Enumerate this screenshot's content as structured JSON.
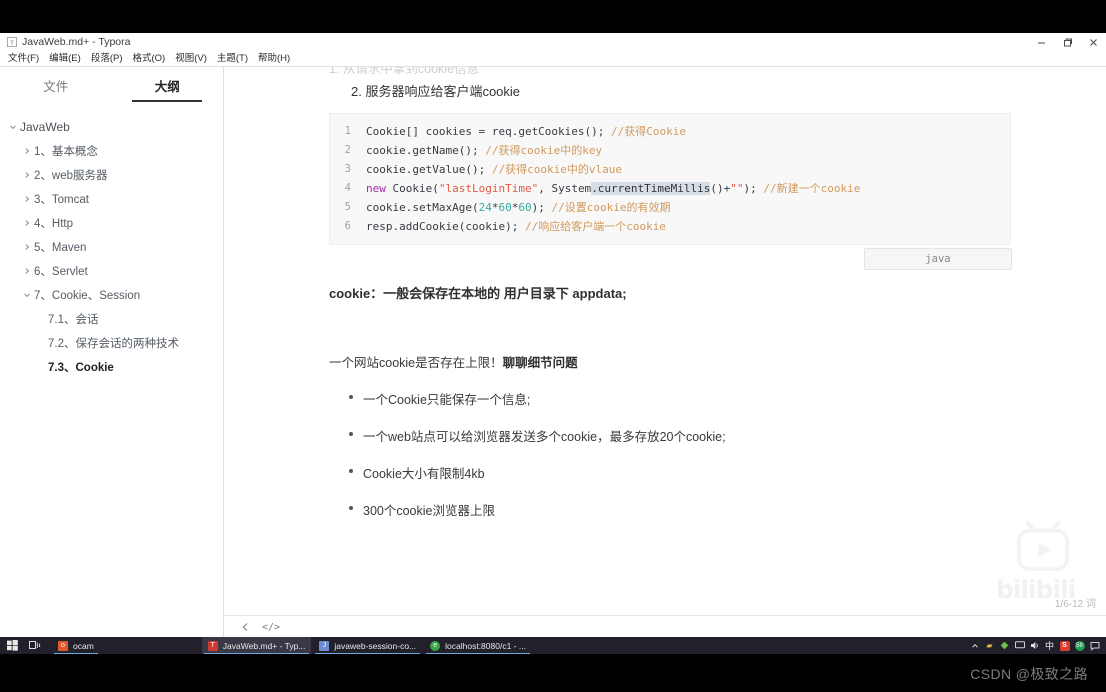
{
  "window": {
    "title": "JavaWeb.md+ - Typora",
    "app_icon": "typora-icon",
    "controls": {
      "minimize": "minimize-icon",
      "restore": "restore-icon",
      "close": "close-icon"
    }
  },
  "menu": {
    "items": [
      {
        "label": "文件(F)",
        "name": "menu-file"
      },
      {
        "label": "编辑(E)",
        "name": "menu-edit"
      },
      {
        "label": "段落(P)",
        "name": "menu-paragraph"
      },
      {
        "label": "格式(O)",
        "name": "menu-format"
      },
      {
        "label": "视图(V)",
        "name": "menu-view"
      },
      {
        "label": "主题(T)",
        "name": "menu-theme"
      },
      {
        "label": "帮助(H)",
        "name": "menu-help"
      }
    ]
  },
  "sidebar": {
    "tabs": [
      {
        "label": "文件",
        "active": false
      },
      {
        "label": "大纲",
        "active": true
      }
    ],
    "outline": [
      {
        "label": "JavaWeb",
        "level": 0,
        "caret": "down",
        "current": false
      },
      {
        "label": "1、基本概念",
        "level": 1,
        "caret": "right",
        "current": false
      },
      {
        "label": "2、web服务器",
        "level": 1,
        "caret": "right",
        "current": false
      },
      {
        "label": "3、Tomcat",
        "level": 1,
        "caret": "right",
        "current": false
      },
      {
        "label": "4、Http",
        "level": 1,
        "caret": "right",
        "current": false
      },
      {
        "label": "5、Maven",
        "level": 1,
        "caret": "right",
        "current": false
      },
      {
        "label": "6、Servlet",
        "level": 1,
        "caret": "right",
        "current": false
      },
      {
        "label": "7、Cookie、Session",
        "level": 1,
        "caret": "down",
        "current": false
      },
      {
        "label": "7.1、会话",
        "level": 2,
        "caret": "none",
        "current": false
      },
      {
        "label": "7.2、保存会话的两种技术",
        "level": 2,
        "caret": "none",
        "current": false
      },
      {
        "label": "7.3、Cookie",
        "level": 2,
        "caret": "none",
        "current": true
      }
    ]
  },
  "document": {
    "clipped_top_ghost": "1. 从请求中拿到cookie信息",
    "heading_ordered": "2. 服务器响应给客户端cookie",
    "code": {
      "language_badge": "java",
      "lines": [
        {
          "n": "1",
          "tokens": [
            {
              "t": "Cookie[] cookies = req.getCookies(); ",
              "c": "plain"
            },
            {
              "t": "//获得Cookie",
              "c": "cmt"
            }
          ]
        },
        {
          "n": "2",
          "tokens": [
            {
              "t": "cookie.getName(); ",
              "c": "plain"
            },
            {
              "t": "//获得cookie中的key",
              "c": "cmt"
            }
          ]
        },
        {
          "n": "3",
          "tokens": [
            {
              "t": "cookie.getValue(); ",
              "c": "plain"
            },
            {
              "t": "//获得cookie中的vlaue",
              "c": "cmt"
            }
          ]
        },
        {
          "n": "4",
          "tokens": [
            {
              "t": "new",
              "c": "kw"
            },
            {
              "t": " Cookie(",
              "c": "plain"
            },
            {
              "t": "\"lastLoginTime\"",
              "c": "str"
            },
            {
              "t": ", System",
              "c": "plain"
            },
            {
              "t": ".currentTimeMillis",
              "c": "sel"
            },
            {
              "t": "()+",
              "c": "plain"
            },
            {
              "t": "\"\"",
              "c": "str"
            },
            {
              "t": "); ",
              "c": "plain"
            },
            {
              "t": "//新建一个cookie",
              "c": "cmt"
            }
          ]
        },
        {
          "n": "5",
          "tokens": [
            {
              "t": "cookie.setMaxAge(",
              "c": "plain"
            },
            {
              "t": "24",
              "c": "num"
            },
            {
              "t": "*",
              "c": "plain"
            },
            {
              "t": "60",
              "c": "num"
            },
            {
              "t": "*",
              "c": "plain"
            },
            {
              "t": "60",
              "c": "num"
            },
            {
              "t": "); ",
              "c": "plain"
            },
            {
              "t": "//设置cookie的有效期",
              "c": "cmt"
            }
          ]
        },
        {
          "n": "6",
          "tokens": [
            {
              "t": "resp.addCookie(cookie); ",
              "c": "plain"
            },
            {
              "t": "//响应给客户端一个cookie",
              "c": "cmt"
            }
          ]
        }
      ]
    },
    "paragraph_cookie_location": "cookie：一般会保存在本地的 用户目录下 appdata;",
    "paragraph_limit_normal": "一个网站cookie是否存在上限！",
    "paragraph_limit_bold": "聊聊细节问题",
    "bullets": [
      "一个Cookie只能保存一个信息;",
      "一个web站点可以给浏览器发送多个cookie，最多存放20个cookie;",
      "Cookie大小有限制4kb",
      "300个cookie浏览器上限"
    ],
    "watermark": {
      "brand": "bilibili",
      "icon": "bilibili-tv-icon"
    },
    "word_count": "1/6-12 词"
  },
  "status_bar": {
    "back_icon": "chevron-left-icon",
    "source_code_icon": "source-code-icon"
  },
  "taskbar": {
    "start_icon": "windows-start-icon",
    "taskview_icon": "task-view-icon",
    "items": [
      {
        "label": "ocam",
        "icon_color": "#e05a2b",
        "icon_glyph": "o",
        "active": false
      },
      {
        "label": "JavaWeb.md+ - Typ...",
        "icon_color": "#cc3b33",
        "icon_glyph": "T",
        "active": true
      },
      {
        "label": "javaweb-session-co...",
        "icon_color": "#6e8bd4",
        "icon_glyph": "J",
        "active": false
      },
      {
        "label": "localhost:8080/c1 - ...",
        "icon_color": "#3aa34a",
        "icon_glyph": "e",
        "active": false
      }
    ],
    "tray": [
      {
        "name": "tray-chevron-up-icon",
        "glyph": "^",
        "color": "#d8d8d8"
      },
      {
        "name": "tray-app-yellow-icon",
        "glyph": "●",
        "color": "#e5b44a"
      },
      {
        "name": "tray-app-green-icon",
        "glyph": "●",
        "color": "#6ec14a"
      },
      {
        "name": "tray-network-icon",
        "glyph": "▭",
        "color": "#cfcfcf"
      },
      {
        "name": "tray-volume-icon",
        "glyph": "◀",
        "color": "#dcdcdc"
      },
      {
        "name": "tray-ime-icon",
        "glyph": "中",
        "color": "#e8e8e8"
      },
      {
        "name": "tray-sogou-icon",
        "glyph": "S",
        "color": "#e03c2d"
      },
      {
        "name": "tray-app-circle-icon",
        "glyph": "58",
        "color": "#1f9d55"
      },
      {
        "name": "tray-action-center-icon",
        "glyph": "▣",
        "color": "#cfcfcf"
      }
    ]
  },
  "overlay": {
    "csdn_watermark": "CSDN @极致之路"
  }
}
